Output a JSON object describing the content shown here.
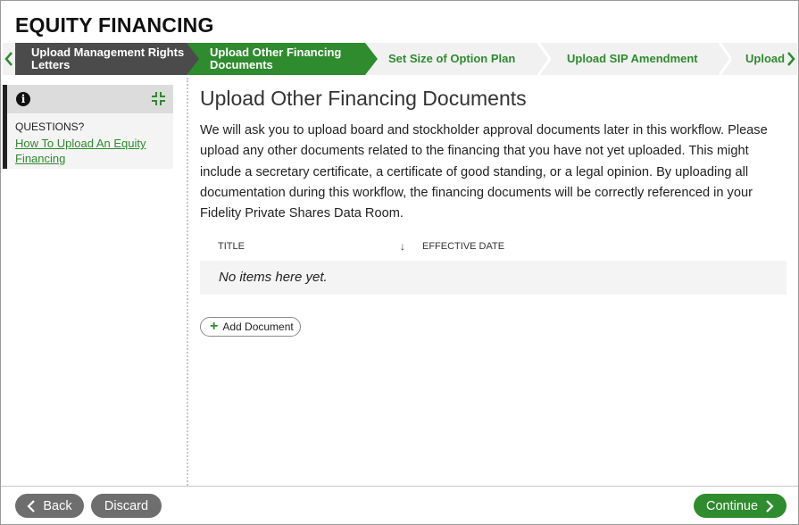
{
  "app": {
    "title": "EQUITY FINANCING"
  },
  "colors": {
    "accent": "#2e8b2e",
    "done_step": "#4b4b4b",
    "neutral_btn": "#6e6e6e"
  },
  "stepper": {
    "prev_icon": "chevron-left-icon",
    "next_icon": "chevron-right-icon",
    "steps": [
      {
        "label": "Upload Management Rights Letters",
        "state": "done"
      },
      {
        "label": "Upload Other Financing Documents",
        "state": "active"
      },
      {
        "label": "Set Size of Option Plan",
        "state": "todo"
      },
      {
        "label": "Upload SIP Amendment",
        "state": "todo"
      },
      {
        "label": "Upload",
        "state": "todo"
      }
    ]
  },
  "sidebar": {
    "info_icon": "info-icon",
    "collapse_icon": "collapse-icon",
    "questions_label": "QUESTIONS?",
    "help_link": "How To Upload An Equity Financing"
  },
  "main": {
    "title": "Upload Other Financing Documents",
    "intro": "We will ask you to upload board and stockholder approval documents later in this workflow. Please upload any other documents related to the financing that you have not yet uploaded. This might include a secretary certificate, a certificate of good standing, or a legal opinion. By uploading all documentation during this workflow, the financing documents will be correctly referenced in your Fidelity Private Shares Data Room.",
    "table": {
      "columns": [
        "TITLE",
        "EFFECTIVE DATE"
      ],
      "sort_icon": "arrow-down-icon",
      "empty_message": "No items here yet."
    },
    "add_document_label": "Add Document"
  },
  "footer": {
    "back_label": "Back",
    "discard_label": "Discard",
    "continue_label": "Continue"
  }
}
